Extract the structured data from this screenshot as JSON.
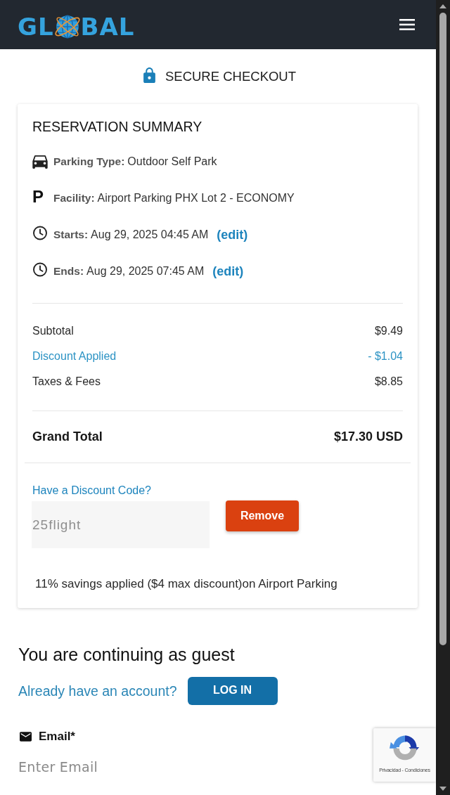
{
  "header": {
    "logo_left": "GL",
    "logo_right": "BAL"
  },
  "secure_banner": {
    "label": "SECURE CHECKOUT"
  },
  "summary": {
    "title": "RESERVATION SUMMARY",
    "details": [
      {
        "kind": "car",
        "label": "Parking Type:",
        "value": "Outdoor Self Park"
      },
      {
        "kind": "letter",
        "icon": "P",
        "label": "Facility:",
        "value": "Airport Parking PHX Lot 2 - ECONOMY"
      },
      {
        "kind": "clock",
        "label": "Starts:",
        "value": "Aug 29, 2025 04:45 AM",
        "link": "(edit)"
      },
      {
        "kind": "clock",
        "label": "Ends:",
        "value": "Aug 29, 2025 07:45 AM",
        "link": "(edit)"
      }
    ],
    "lines": [
      {
        "kind": "charge",
        "label": "Subtotal",
        "amount": "$9.49"
      },
      {
        "kind": "discount",
        "label": "Discount Applied",
        "amount": "- $1.04"
      },
      {
        "kind": "charge",
        "label": "Taxes & Fees",
        "amount": "$8.85"
      }
    ],
    "grand_total": {
      "label": "Grand Total",
      "amount": "$17.30 USD"
    },
    "discount_code": {
      "label": "Have a Discount Code?",
      "value": "25flight",
      "disabled": true,
      "button": "Remove",
      "note": "11% savings applied ($4 max discount)on Airport Parking"
    }
  },
  "guest": {
    "title": "You are continuing as guest",
    "prompt": "Already have an account?",
    "button": "LOG IN"
  },
  "email": {
    "label": "Email*",
    "placeholder": "Enter Email"
  },
  "recaptcha": {
    "footer": "Privacidad - Condiciones"
  }
}
